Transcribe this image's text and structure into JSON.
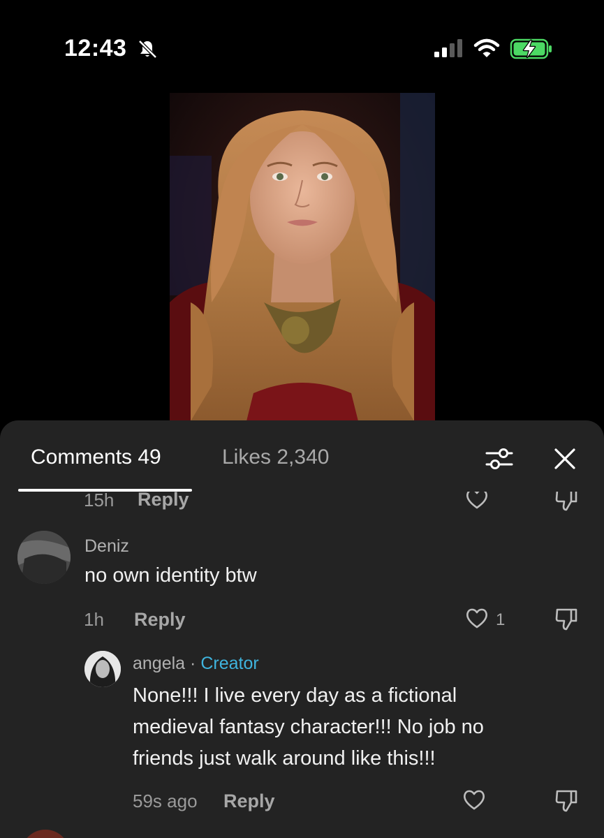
{
  "status_bar": {
    "time": "12:43",
    "silent_icon": "bell-slash-icon",
    "signal_icon": "cellular-signal-icon",
    "wifi_icon": "wifi-icon",
    "battery_icon": "battery-charging-icon",
    "battery_color": "#4cd964"
  },
  "video": {
    "description_icon": "video-frame"
  },
  "sheet": {
    "tabs": [
      {
        "label": "Comments 49",
        "active": true
      },
      {
        "label": "Likes 2,340",
        "active": false
      }
    ],
    "filter_icon": "sliders-icon",
    "close_icon": "close-icon"
  },
  "comments": [
    {
      "partial": true,
      "time": "15h",
      "reply_label": "Reply",
      "like_icon": "heart-outline-icon",
      "dislike_icon": "thumbs-down-icon"
    },
    {
      "username": "Deniz",
      "text": "no own identity btw",
      "time": "1h",
      "reply_label": "Reply",
      "like_count": "1",
      "like_icon": "heart-outline-icon",
      "dislike_icon": "thumbs-down-icon",
      "replies": [
        {
          "username": "angela",
          "separator": "·",
          "badge": "Creator",
          "text_lines": [
            "None!!! I live every day as a fictional",
            "medieval fantasy character!!! No job no",
            "friends just walk around like this!!!"
          ],
          "time": "59s ago",
          "reply_label": "Reply",
          "like_icon": "heart-outline-icon",
          "dislike_icon": "thumbs-down-icon"
        }
      ]
    }
  ],
  "colors": {
    "sheet_bg": "#232323",
    "creator_badge": "#3fb4de",
    "muted_text": "#a7a7a7"
  }
}
